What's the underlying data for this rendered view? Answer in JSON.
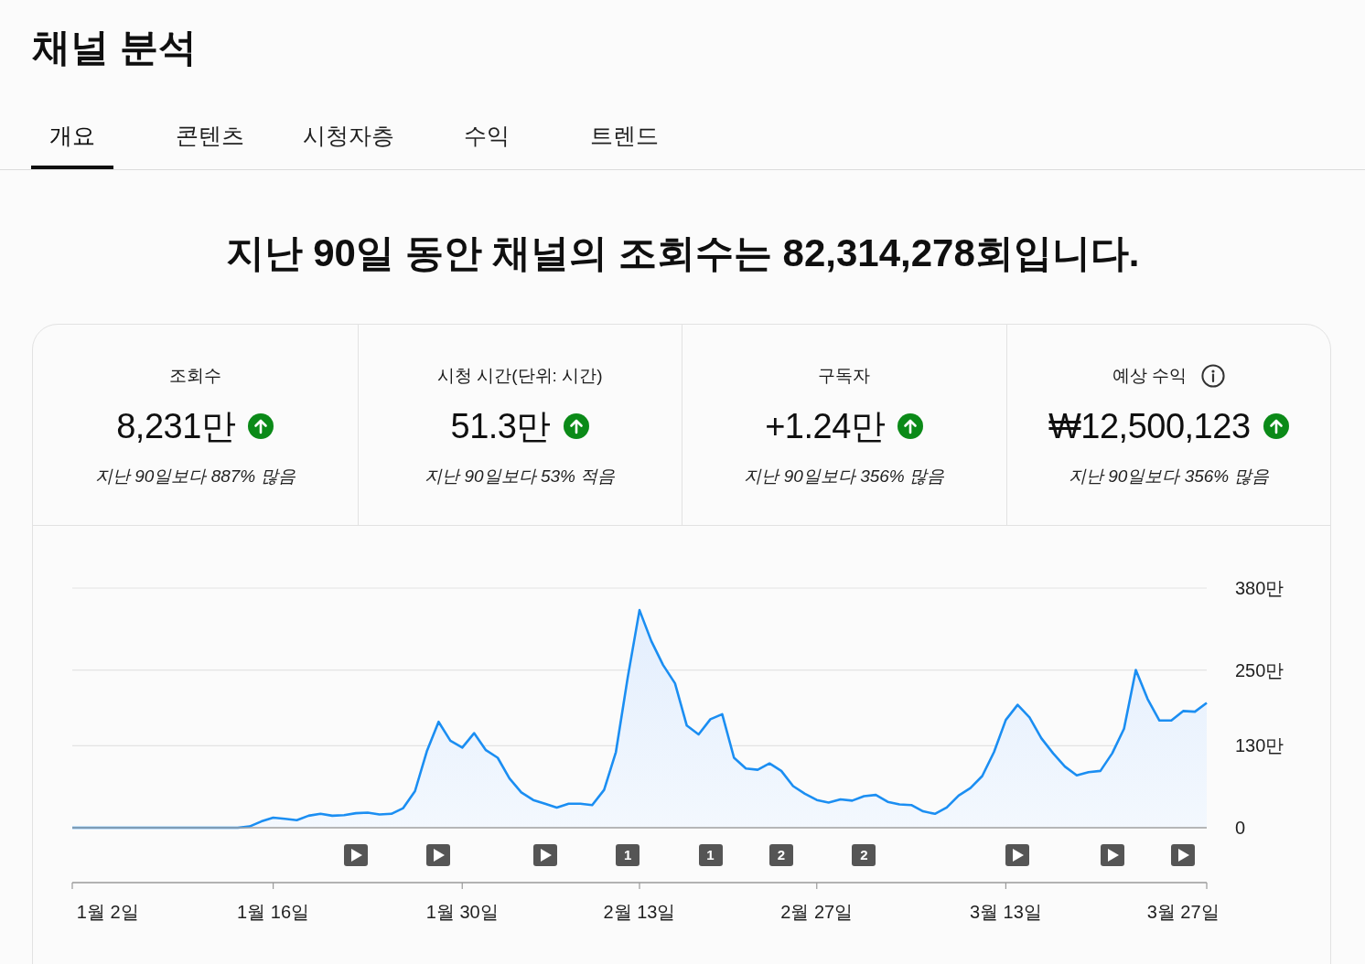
{
  "page": {
    "title": "채널 분석"
  },
  "tabs": [
    {
      "label": "개요",
      "selected": true
    },
    {
      "label": "콘텐츠",
      "selected": false
    },
    {
      "label": "시청자층",
      "selected": false
    },
    {
      "label": "수익",
      "selected": false
    },
    {
      "label": "트렌드",
      "selected": false
    }
  ],
  "headline": "지난 90일 동안 채널의 조회수는 82,314,278회입니다.",
  "metrics": [
    {
      "label": "조회수",
      "info": false,
      "value": "8,231만",
      "rising": true,
      "delta": "지난 90일보다 887% 많음"
    },
    {
      "label": "시청 시간(단위: 시간)",
      "info": false,
      "value": "51.3만",
      "rising": true,
      "delta": "지난 90일보다 53% 적음"
    },
    {
      "label": "구독자",
      "info": false,
      "value": "+1.24만",
      "rising": true,
      "delta": "지난 90일보다 356% 많음"
    },
    {
      "label": "예상 수익",
      "info": true,
      "value": "₩12,500,123",
      "rising": true,
      "delta": "지난 90일보다 356% 많음"
    }
  ],
  "chart": {
    "chart_data": {
      "type": "area",
      "ylim": [
        0,
        380
      ],
      "yticks": [
        {
          "value": 0,
          "label": "0"
        },
        {
          "value": 130,
          "label": "130만"
        },
        {
          "value": 250,
          "label": "250만"
        },
        {
          "value": 380,
          "label": "380만"
        }
      ],
      "categories": [
        null,
        null,
        null,
        "1월 2일",
        null,
        null,
        null,
        null,
        null,
        null,
        null,
        null,
        null,
        null,
        null,
        null,
        null,
        "1월 16일",
        null,
        null,
        null,
        null,
        null,
        null,
        null,
        null,
        null,
        null,
        null,
        null,
        null,
        null,
        null,
        "1월 30일",
        null,
        null,
        null,
        null,
        null,
        null,
        null,
        null,
        null,
        null,
        null,
        null,
        null,
        null,
        "2월 13일",
        null,
        null,
        null,
        null,
        null,
        null,
        null,
        null,
        null,
        null,
        null,
        null,
        null,
        null,
        "2월 27일",
        null,
        null,
        null,
        null,
        null,
        null,
        null,
        null,
        null,
        null,
        null,
        null,
        null,
        null,
        null,
        "3월 13일",
        null,
        null,
        null,
        null,
        null,
        null,
        null,
        null,
        null,
        null,
        null,
        null,
        null,
        null,
        "3월 27일",
        null,
        null
      ],
      "values": [
        0,
        0,
        0,
        0,
        0,
        0,
        0,
        0,
        0,
        0,
        0,
        0,
        0,
        0,
        0,
        2,
        10,
        16,
        14,
        12,
        19,
        22,
        19,
        20,
        23,
        24,
        21,
        22,
        31,
        58,
        121,
        168,
        138,
        127,
        150,
        123,
        111,
        78,
        56,
        44,
        38,
        32,
        38,
        38,
        36,
        60,
        120,
        238,
        345,
        296,
        258,
        229,
        162,
        148,
        172,
        180,
        111,
        94,
        92,
        102,
        90,
        66,
        54,
        44,
        40,
        45,
        43,
        50,
        52,
        41,
        37,
        36,
        26,
        22,
        32,
        51,
        63,
        82,
        120,
        171,
        195,
        175,
        142,
        118,
        97,
        83,
        88,
        90,
        118,
        157,
        250,
        204,
        170,
        170,
        185,
        184,
        198
      ]
    },
    "markers": [
      {
        "kind": "video"
      },
      {
        "kind": "video"
      },
      {
        "kind": "video"
      },
      {
        "kind": "count",
        "label": "1"
      },
      {
        "kind": "count",
        "label": "1"
      },
      {
        "kind": "count",
        "label": "2"
      },
      {
        "kind": "count",
        "label": "2"
      },
      {
        "kind": "video"
      },
      {
        "kind": "video"
      },
      {
        "kind": "video"
      }
    ]
  }
}
